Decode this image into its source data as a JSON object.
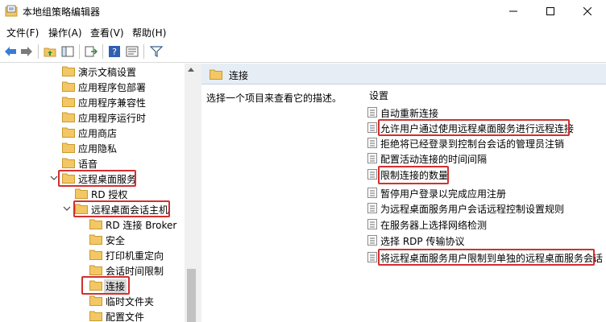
{
  "window": {
    "title": "本地组策略编辑器"
  },
  "menu": {
    "items": [
      "文件(F)",
      "操作(A)",
      "查看(V)",
      "帮助(H)"
    ]
  },
  "tree": {
    "items": [
      {
        "label": "演示文稿设置"
      },
      {
        "label": "应用程序包部署"
      },
      {
        "label": "应用程序兼容性"
      },
      {
        "label": "应用程序运行时"
      },
      {
        "label": "应用商店"
      },
      {
        "label": "应用隐私"
      },
      {
        "label": "语音"
      },
      {
        "label": "远程桌面服务"
      },
      {
        "label": "RD 授权"
      },
      {
        "label": "远程桌面会话主机"
      },
      {
        "label": "RD 连接 Broker"
      },
      {
        "label": "安全"
      },
      {
        "label": "打印机重定向"
      },
      {
        "label": "会话时间限制"
      },
      {
        "label": "连接"
      },
      {
        "label": "临时文件夹"
      },
      {
        "label": "配置文件"
      }
    ]
  },
  "right_pane": {
    "header_label": "连接",
    "description": "选择一个项目来查看它的描述。",
    "list_header": "设置",
    "settings": [
      {
        "label": "自动重新连接"
      },
      {
        "label": "允许用户通过使用远程桌面服务进行远程连接"
      },
      {
        "label": "拒绝将已经登录到控制台会话的管理员注销"
      },
      {
        "label": "配置活动连接的时间间隔"
      },
      {
        "label": "限制连接的数量"
      },
      {
        "label": "暂停用户登录以完成应用注册"
      },
      {
        "label": "为远程桌面服务用户会话远程控制设置规则"
      },
      {
        "label": "在服务器上选择网络检测"
      },
      {
        "label": "选择 RDP 传输协议"
      },
      {
        "label": "将远程桌面服务用户限制到单独的远程桌面服务会话"
      }
    ]
  },
  "colors": {
    "highlight_box": "#d32f2f",
    "folder_fill": "#f3c765",
    "header_bg": "#e6edf5"
  }
}
